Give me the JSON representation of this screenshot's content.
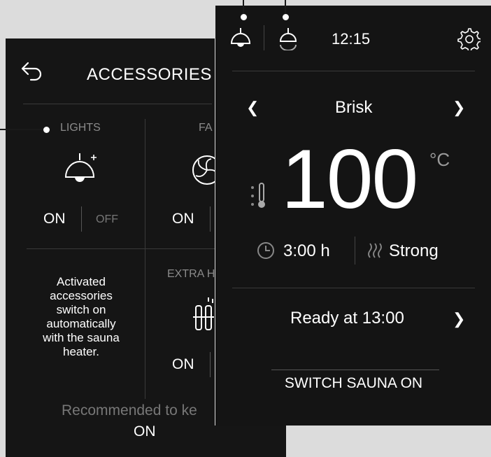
{
  "accessories": {
    "back_icon": "back-arrow-icon",
    "title": "ACCESSORIES",
    "lights": {
      "label": "LIGHTS",
      "icon": "lamp-icon",
      "on": "ON",
      "off": "OFF"
    },
    "fan": {
      "label": "FA",
      "icon": "fan-icon",
      "on": "ON"
    },
    "extra_heater": {
      "label": "EXTRA H",
      "icon": "heater-icon",
      "on": "ON"
    },
    "info": [
      "Activated",
      "accessories",
      "switch on",
      "automatically",
      "with the sauna",
      "heater."
    ],
    "recommended": "Recommended to ke",
    "recommended_value": "ON"
  },
  "main": {
    "status_icons": [
      "lamp-icon",
      "fan-running-icon"
    ],
    "time": "12:15",
    "settings_icon": "gear-icon",
    "program": "Brisk",
    "temperature": "100",
    "unit": "°C",
    "duration": "3:00 h",
    "steam": "Strong",
    "ready": "Ready at 13:00",
    "switch": "SWITCH SAUNA ON"
  }
}
